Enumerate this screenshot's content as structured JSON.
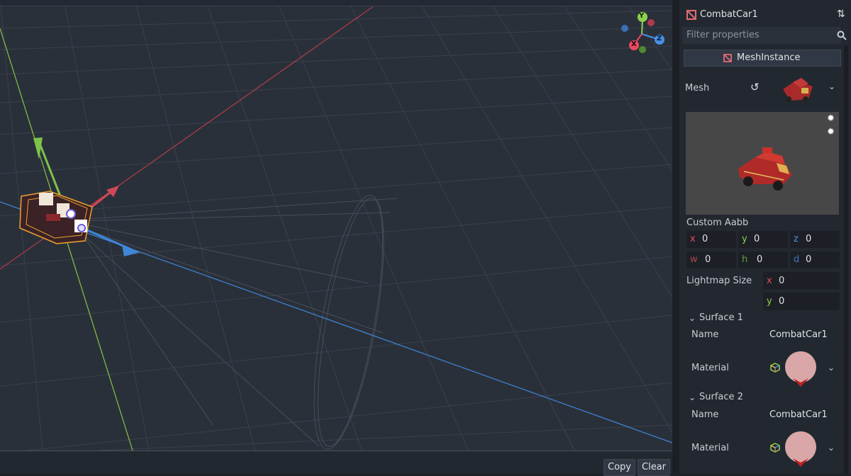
{
  "console": {
    "copy_label": "Copy",
    "clear_label": "Clear"
  },
  "gizmo": {
    "y": "Y",
    "x": "X",
    "z": "Z"
  },
  "inspector": {
    "node_name": "CombatCar1",
    "filter_placeholder": "Filter properties",
    "section_title": "MeshInstance",
    "mesh_label": "Mesh",
    "custom_aabb_label": "Custom Aabb",
    "aabb": [
      {
        "axis": "x",
        "value": "0"
      },
      {
        "axis": "y",
        "value": "0"
      },
      {
        "axis": "z",
        "value": "0"
      },
      {
        "axis": "w",
        "value": "0"
      },
      {
        "axis": "h",
        "value": "0"
      },
      {
        "axis": "d",
        "value": "0"
      }
    ],
    "lightmap_label": "Lightmap Size",
    "lightmap": [
      {
        "axis": "x",
        "value": "0"
      },
      {
        "axis": "y",
        "value": "0"
      }
    ],
    "surfaces": [
      {
        "title": "Surface 1",
        "name_label": "Name",
        "name_value": "CombatCar1",
        "material_label": "Material"
      },
      {
        "title": "Surface 2",
        "name_label": "Name",
        "name_value": "CombatCar1",
        "material_label": "Material"
      }
    ]
  },
  "colors": {
    "x_axis": "#e84a5f",
    "y_axis": "#8fd14f",
    "z_axis": "#4a90e2",
    "accent": "#e06c75"
  }
}
